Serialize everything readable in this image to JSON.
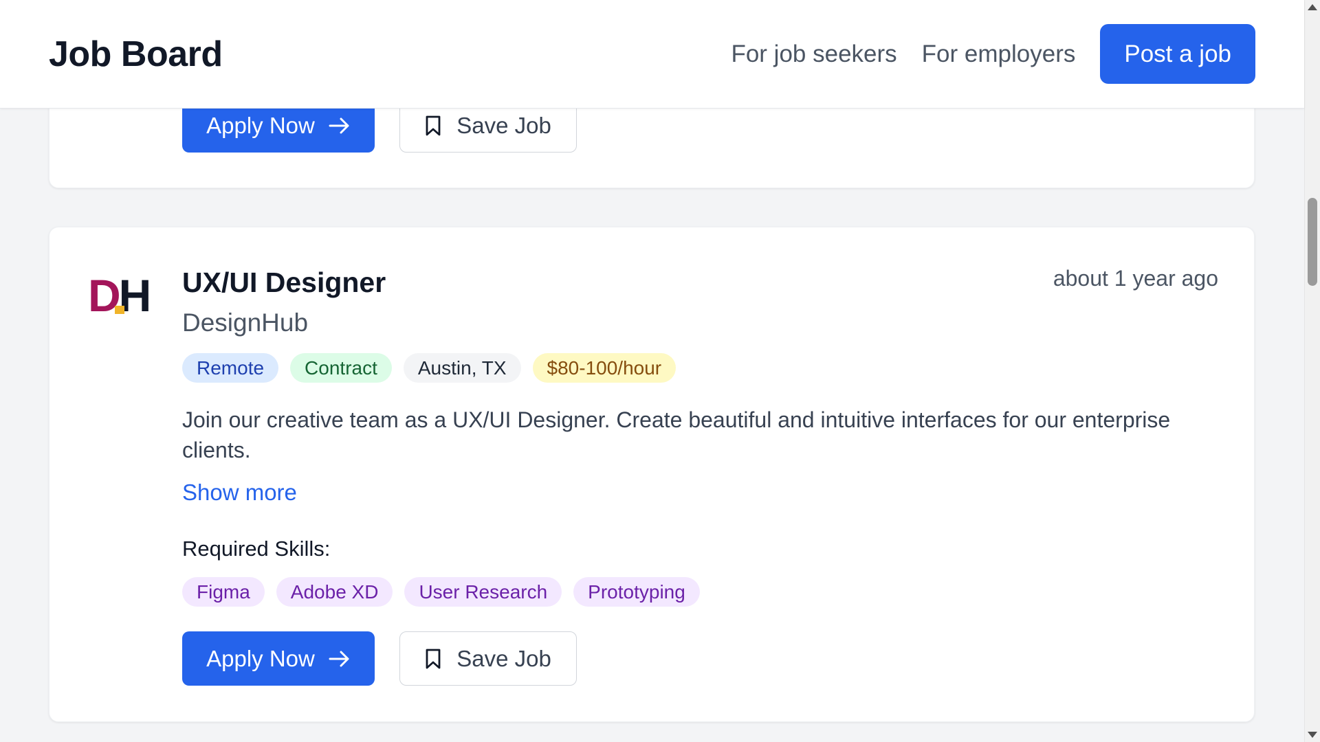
{
  "header": {
    "brand": "Job Board",
    "nav": [
      "For job seekers",
      "For employers"
    ],
    "post_button": "Post a job"
  },
  "previous_card": {
    "apply_label": "Apply Now",
    "save_label": "Save Job"
  },
  "job": {
    "logo_letters": "DH",
    "title": "UX/UI Designer",
    "company": "DesignHub",
    "posted": "about 1 year ago",
    "tags": {
      "work_mode": "Remote",
      "type": "Contract",
      "location": "Austin, TX",
      "rate": "$80-100/hour"
    },
    "description": "Join our creative team as a UX/UI Designer. Create beautiful and intuitive interfaces for our enterprise clients.",
    "show_more": "Show more",
    "skills_label": "Required Skills:",
    "skills": [
      "Figma",
      "Adobe XD",
      "User Research",
      "Prototyping"
    ],
    "apply_label": "Apply Now",
    "save_label": "Save Job"
  },
  "colors": {
    "primary": "#2563eb",
    "logo_magenta": "#a3155a",
    "logo_yellow": "#f0b429"
  },
  "icons": [
    "arrow-right-icon",
    "bookmark-icon"
  ]
}
